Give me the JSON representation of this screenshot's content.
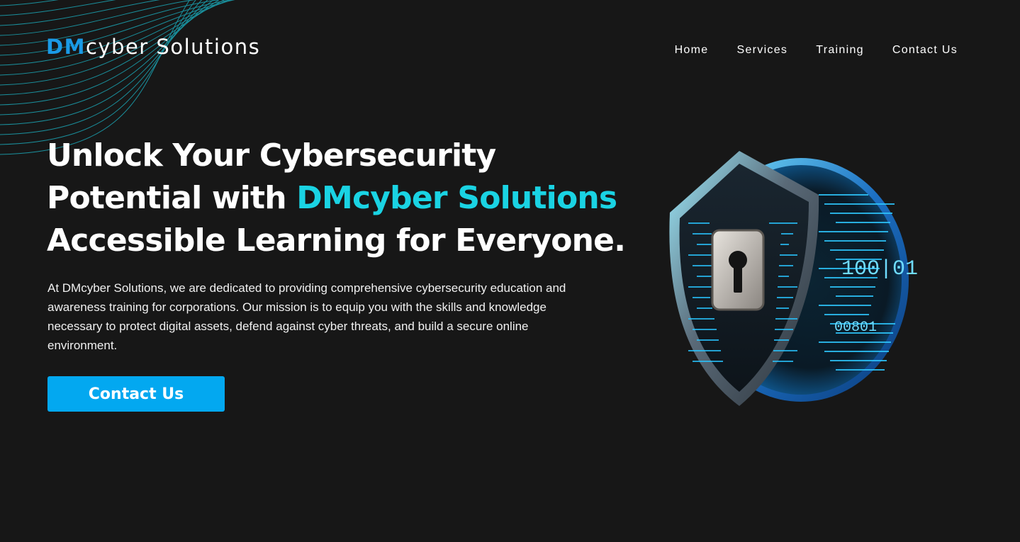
{
  "header": {
    "logo_accent": "DM",
    "logo_rest": "cyber Solutions",
    "nav": [
      "Home",
      "Services",
      "Training",
      "Contact Us"
    ]
  },
  "hero": {
    "title_line1": "Unlock Your Cybersecurity",
    "title_line2_prefix": "Potential with ",
    "title_line2_highlight": "DMcyber Solutions",
    "title_line3": "Accessible Learning for Everyone.",
    "description": "At DMcyber Solutions, we are dedicated to providing comprehensive cybersecurity education and awareness training for corporations. Our mission is to equip you with the skills and knowledge necessary to protect digital assets, defend against cyber threats, and build a secure online environment.",
    "cta_label": "Contact Us"
  },
  "illustration": {
    "readout_1": "100|01",
    "readout_2": "00801"
  },
  "colors": {
    "background": "#171717",
    "logo_accent": "#1a9ae6",
    "title_highlight": "#1ad3e3",
    "cta_background": "#03a8f0"
  }
}
